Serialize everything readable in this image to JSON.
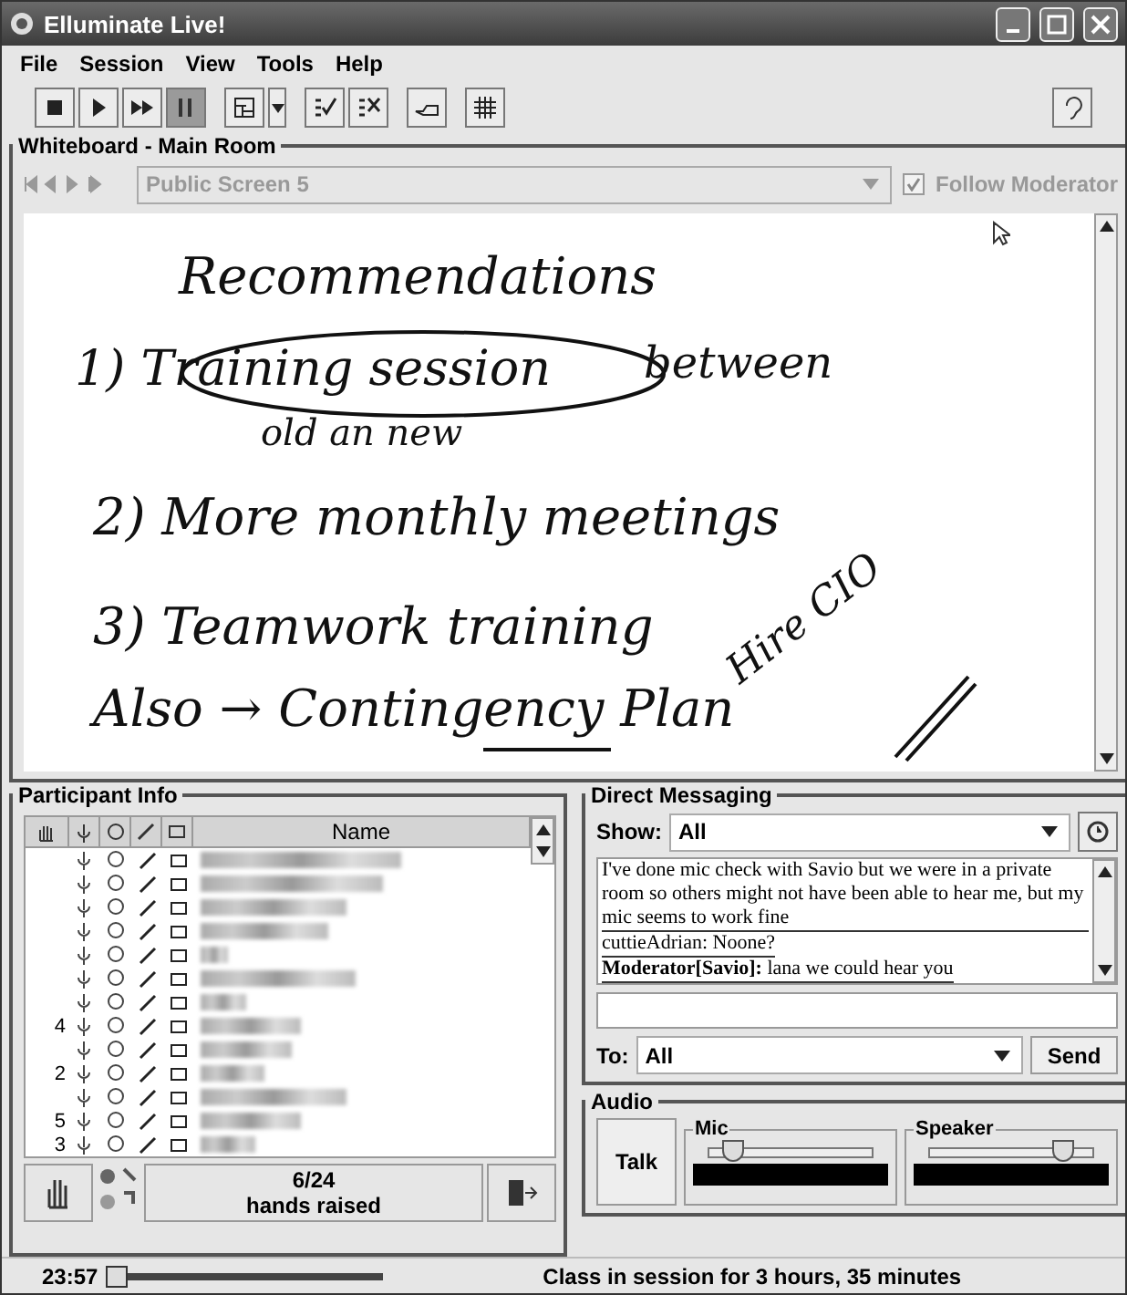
{
  "window": {
    "title": "Elluminate Live!"
  },
  "menu": [
    "File",
    "Session",
    "View",
    "Tools",
    "Help"
  ],
  "toolbar": [
    {
      "kind": "stop",
      "pressed": false
    },
    {
      "kind": "play",
      "pressed": false
    },
    {
      "kind": "forward",
      "pressed": false
    },
    {
      "kind": "pause",
      "pressed": true
    },
    {
      "kind": "layout",
      "pressed": false
    },
    {
      "kind": "check",
      "pressed": false
    },
    {
      "kind": "cross",
      "pressed": false
    },
    {
      "kind": "hand",
      "pressed": false
    },
    {
      "kind": "grid",
      "pressed": false
    }
  ],
  "whiteboard": {
    "title": "Whiteboard - Main Room",
    "screen": "Public Screen 5",
    "follow_moderator": {
      "label": "Follow Moderator",
      "checked": true
    },
    "lines": [
      {
        "text": "Recommendations",
        "kind": "heading"
      },
      {
        "text": "1) Training session",
        "kind": "circled"
      },
      {
        "text": "between",
        "kind": "side"
      },
      {
        "text": "old an new",
        "kind": "sub"
      },
      {
        "text": "2) More monthly meetings",
        "kind": "item"
      },
      {
        "text": "3) Teamwork training",
        "kind": "item"
      },
      {
        "text": "Also → Contingency Plan",
        "kind": "item"
      },
      {
        "text": "Hire CIO",
        "kind": "slanted"
      }
    ]
  },
  "participants": {
    "title": "Participant Info",
    "name_column": "Name",
    "rows": [
      {},
      {},
      {},
      {},
      {},
      {},
      {},
      {
        "hand": "4"
      },
      {},
      {
        "hand": "2"
      },
      {},
      {
        "hand": "5"
      },
      {
        "hand": "3"
      }
    ],
    "count": "6/24",
    "count_label": "hands raised"
  },
  "messaging": {
    "title": "Direct Messaging",
    "show_label": "Show:",
    "show": "All",
    "messages": [
      {
        "text": "I've done mic check with Savio but we were in a private room so others might not have been able to hear me, but my mic seems to work fine"
      },
      {
        "text": "cuttieAdrian: Noone?"
      },
      {
        "sender": "Moderator[Savio]:",
        "text": "lana  we could hear you"
      }
    ],
    "to_label": "To:",
    "to": "All",
    "send": "Send"
  },
  "audio": {
    "title": "Audio",
    "talk": "Talk",
    "mic": {
      "label": "Mic",
      "level": 0.15
    },
    "speaker": {
      "label": "Speaker",
      "level": 0.82
    }
  },
  "status": {
    "time": "23:57",
    "level": 0.03,
    "message": "Class in session for 3 hours, 35 minutes"
  }
}
